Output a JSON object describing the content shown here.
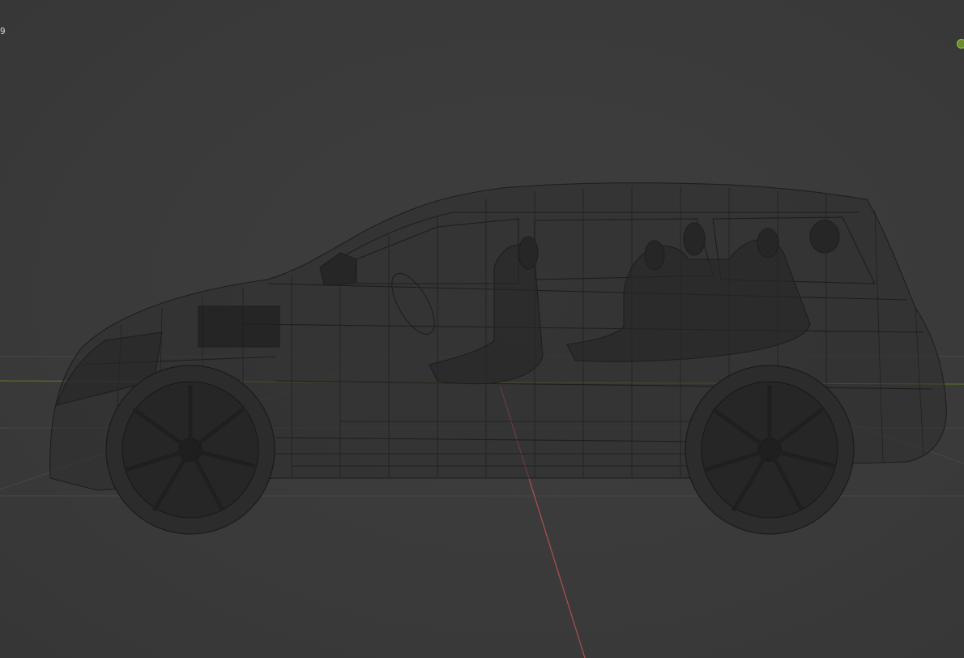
{
  "viewport": {
    "overlay_text": "9",
    "colors": {
      "background": "#3b3b3b",
      "grid_line": "#4a4a4a",
      "x_axis": "#c0504d",
      "y_axis": "#6f8f2a",
      "wire": "#1c1c1c",
      "gizmo": "#6a8c2c"
    },
    "gizmo_icon": "navigation-gizmo-dot"
  }
}
